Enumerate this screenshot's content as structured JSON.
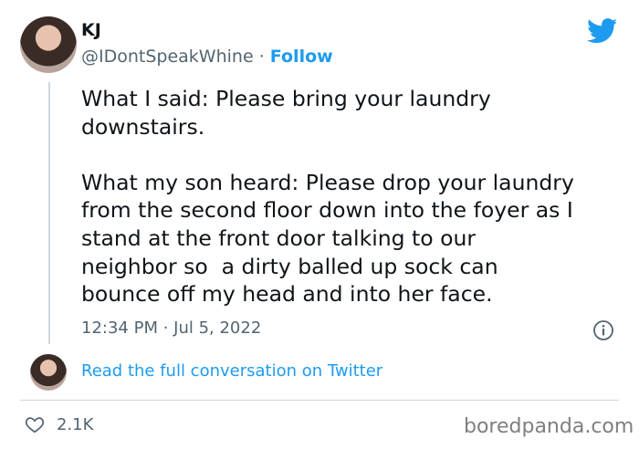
{
  "author": {
    "display_name": "KJ",
    "handle": "@IDontSpeakWhine",
    "separator": "·",
    "follow_label": "Follow"
  },
  "tweet": {
    "text": "What I said: Please bring your laundry\ndownstairs.\n\nWhat my son heard: Please drop your laundry\nfrom the second floor down into the foyer as I\nstand at the front door talking to our\nneighbor so  a dirty balled up sock can\nbounce off my head and into her face.",
    "timestamp": "12:34 PM · Jul 5, 2022"
  },
  "conversation_link": "Read the full conversation on Twitter",
  "likes": {
    "count": "2.1K"
  },
  "watermark": "boredpanda.com",
  "colors": {
    "accent": "#1d9bf0",
    "text": "#0f1419",
    "muted": "#536471",
    "border": "#cfd9de"
  },
  "icons": [
    "twitter-bird-icon",
    "info-icon",
    "heart-icon"
  ]
}
